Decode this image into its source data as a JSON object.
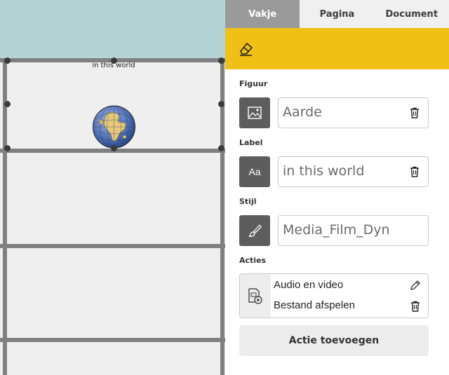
{
  "canvas": {
    "cell_label": "in this world"
  },
  "tabs": [
    {
      "label": "Vakje",
      "active": true
    },
    {
      "label": "Pagina",
      "active": false
    },
    {
      "label": "Document",
      "active": false
    }
  ],
  "toolbar": {
    "icon": "eraser-icon",
    "color": "#f0c014"
  },
  "sections": {
    "figure": {
      "title": "Figuur",
      "value": "Aarde",
      "icon": "image-icon"
    },
    "label": {
      "title": "Label",
      "value": "in this world",
      "icon": "text-aa-icon"
    },
    "style": {
      "title": "Stijl",
      "value": "Media_Film_Dyn",
      "icon": "brush-icon"
    },
    "actions": {
      "title": "Acties",
      "items": [
        {
          "label": "Audio en video",
          "icon": "pencil-icon"
        },
        {
          "label": "Bestand afspelen",
          "icon": "trash-icon"
        }
      ],
      "add_label": "Actie toevoegen"
    }
  }
}
